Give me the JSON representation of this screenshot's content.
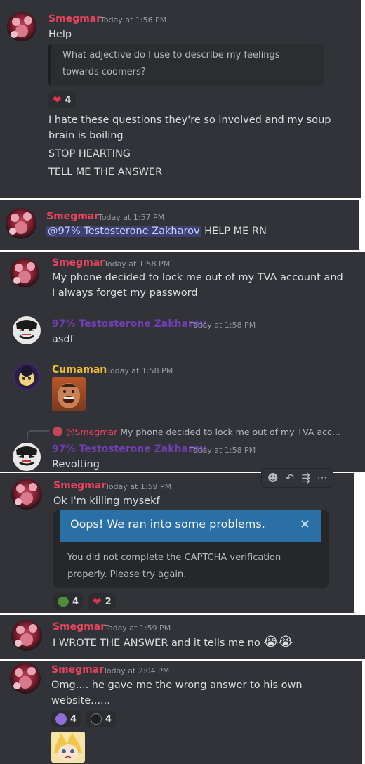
{
  "colors": {
    "smegmar": "#e9435f",
    "zakharov": "#6f3fb0",
    "cumaman": "#f0c12e",
    "background": "#313338"
  },
  "messages": [
    {
      "author": "Smegmar",
      "time": "Today at 1:56 PM",
      "lines": [
        "Help"
      ],
      "quote": [
        "What adjective do I use to describe my feelings",
        "towards coomers?"
      ],
      "reaction": {
        "icon": "heart-icon",
        "count": "4"
      },
      "extra_lines": [
        "I hate these questions they're so involved and my soup",
        "brain is boiling",
        "STOP HEARTING",
        "TELL ME THE ANSWER"
      ]
    },
    {
      "author": "Smegmar",
      "time": "Today at 1:57 PM",
      "mention": "@97% Testosterone Zakharov",
      "text": "HELP ME RN"
    },
    {
      "author": "Smegmar",
      "time": "Today at 1:58 PM",
      "lines": [
        "My phone decided to lock me out of my TVA account and",
        "I always forget my password"
      ]
    },
    {
      "author": "97% Testosterone Zakharov",
      "time": "Today at 1:58 PM",
      "lines": [
        "asdf"
      ]
    },
    {
      "author": "Cumaman",
      "time": "Today at 1:58 PM",
      "image": "reaction-gif"
    },
    {
      "reply_author": "@Smegmar",
      "reply_text": "My phone decided to lock me out of my TVA acc...",
      "author": "97% Testosterone Zakharov",
      "time": "Today at 1:58 PM",
      "lines": [
        "Revolting"
      ]
    },
    {
      "author": "Smegmar",
      "time": "Today at 1:59 PM",
      "lines": [
        "Ok I'm killing mysekf"
      ],
      "error_title": "Oops! We ran into some problems.",
      "error_close": "×",
      "error_lines": [
        "You did not complete the CAPTCHA verification",
        "properly. Please try again."
      ],
      "reactions": [
        {
          "icon": "pepe-emoji",
          "count": "4"
        },
        {
          "icon": "heart-icon",
          "count": "2"
        }
      ]
    },
    {
      "author": "Smegmar",
      "time": "Today at 1:59 PM",
      "text": "I WROTE THE ANSWER and it tells me no",
      "emoji": "😭😭"
    },
    {
      "author": "Smegmar",
      "time": "Today at 2:04 PM",
      "lines": [
        "Omg.... he gave me the wrong answer to his own",
        "website......"
      ],
      "reactions": [
        {
          "icon": "anime-emoji",
          "count": "4"
        },
        {
          "icon": "eye-emoji",
          "count": "4"
        }
      ],
      "image": "anime-sticker"
    }
  ],
  "toolbar": {
    "icons": [
      "add-reaction-icon",
      "reply-icon",
      "forward-icon",
      "more-icon"
    ],
    "more_label": "···"
  }
}
